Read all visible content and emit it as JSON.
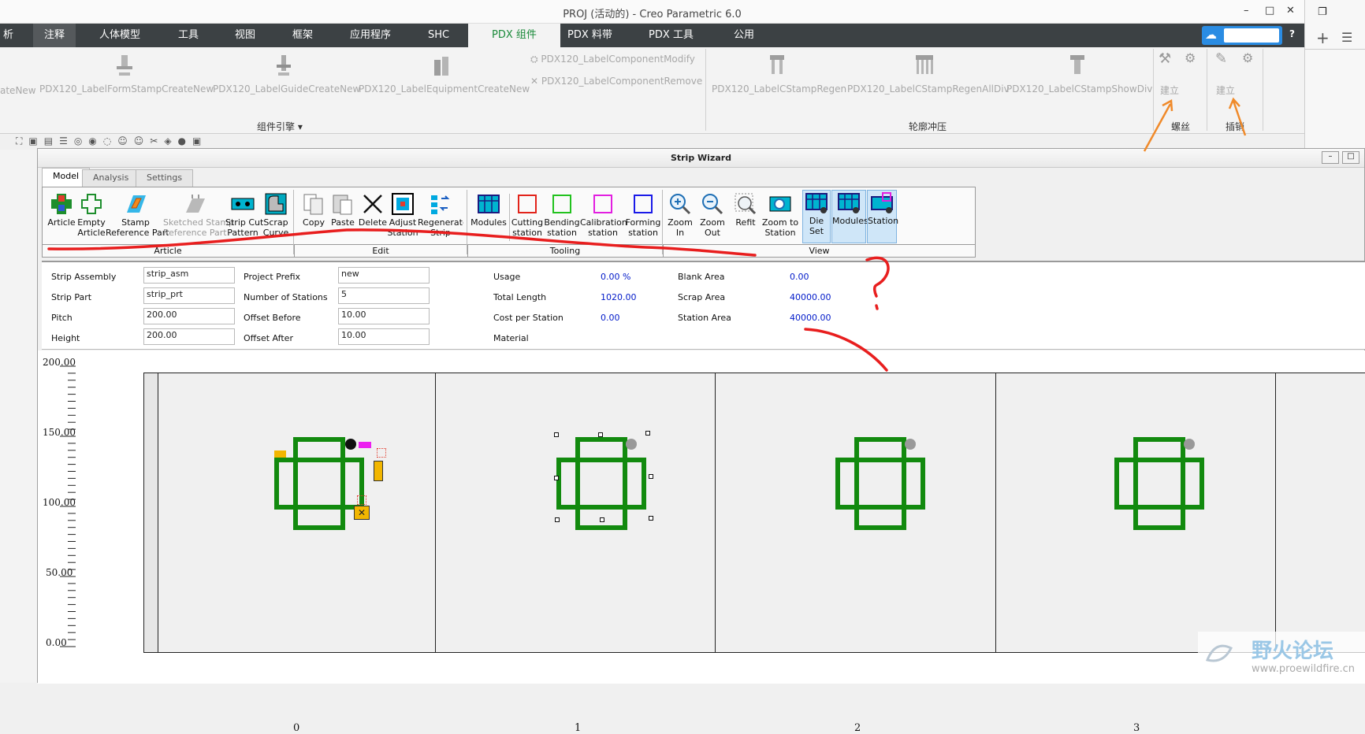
{
  "window": {
    "title": "PROJ (活动的) - Creo Parametric 6.0",
    "minimize": "–",
    "maximize": "□",
    "close": "✕"
  },
  "ribbon_tabs": [
    "析",
    "注释",
    "人体模型",
    "工具",
    "视图",
    "框架",
    "应用程序",
    "SHC",
    "PDX 组件",
    "PDX 料带",
    "PDX 工具",
    "公用"
  ],
  "ribbon": {
    "buttons": [
      "ateNew",
      "PDX120_LabelFormStampCreateNew",
      "PDX120_LabelGuideCreateNew",
      "PDX120_LabelEquipmentCreateNew",
      "PDX120_LabelComponentModify",
      "PDX120_LabelComponentRemove",
      "PDX120_LabelCStampRegen",
      "PDX120_LabelCStampRegenAllDiv",
      "PDX120_LabelCStampShowDiv"
    ],
    "groups": [
      "组件引擎 ▾",
      "轮廓冲压",
      "螺丝",
      "插销"
    ],
    "small_labels": [
      "建立",
      "建立"
    ]
  },
  "wizard": {
    "title": "Strip Wizard",
    "tabs": [
      "Model",
      "Analysis",
      "Settings"
    ],
    "toolbar": {
      "model": [
        {
          "label": "Article"
        },
        {
          "label": "Empty\nArticle"
        },
        {
          "label": "Stamp\nReference Part"
        },
        {
          "label": "Sketched Stamp\nReference Part"
        },
        {
          "label": "Strip Cut\nPattern"
        },
        {
          "label": "Scrap\nCurve"
        }
      ],
      "edit": [
        {
          "label": "Copy"
        },
        {
          "label": "Paste"
        },
        {
          "label": "Delete"
        },
        {
          "label": "Adjust\nStation"
        },
        {
          "label": "Regenerate\nStrip"
        }
      ],
      "tooling": [
        {
          "label": "Modules"
        },
        {
          "label": "Cutting\nstation"
        },
        {
          "label": "Bending\nstation"
        },
        {
          "label": "Calibration\nstation"
        },
        {
          "label": "Forming\nstation"
        }
      ],
      "view": [
        {
          "label": "Zoom\nIn"
        },
        {
          "label": "Zoom\nOut"
        },
        {
          "label": "Refit"
        },
        {
          "label": "Zoom to\nStation"
        },
        {
          "label": "Die\nSet"
        },
        {
          "label": "Modules"
        },
        {
          "label": "Station"
        }
      ],
      "groups": [
        "Article",
        "Edit",
        "Tooling",
        "View"
      ]
    },
    "props": {
      "strip_assembly_label": "Strip Assembly",
      "strip_assembly": "strip_asm",
      "strip_part_label": "Strip Part",
      "strip_part": "strip_prt",
      "pitch_label": "Pitch",
      "pitch": "200.00",
      "height_label": "Height",
      "height": "200.00",
      "project_prefix_label": "Project Prefix",
      "project_prefix": "new",
      "num_stations_label": "Number of Stations",
      "num_stations": "5",
      "offset_before_label": "Offset Before",
      "offset_before": "10.00",
      "offset_after_label": "Offset After",
      "offset_after": "10.00",
      "usage_label": "Usage",
      "usage": "0.00 %",
      "total_length_label": "Total Length",
      "total_length": "1020.00",
      "cost_label": "Cost per Station",
      "cost": "0.00",
      "material_label": "Material",
      "blank_area_label": "Blank Area",
      "blank_area": "0.00",
      "scrap_area_label": "Scrap Area",
      "scrap_area": "40000.00",
      "station_area_label": "Station Area",
      "station_area": "40000.00"
    },
    "ruler": [
      "200.00",
      "150.00",
      "100.00",
      "50.00",
      "0.00"
    ],
    "stations": [
      "0",
      "1",
      "2",
      "3"
    ]
  },
  "watermark": {
    "text": "野火论坛",
    "url": "www.proewildfire.cn"
  }
}
